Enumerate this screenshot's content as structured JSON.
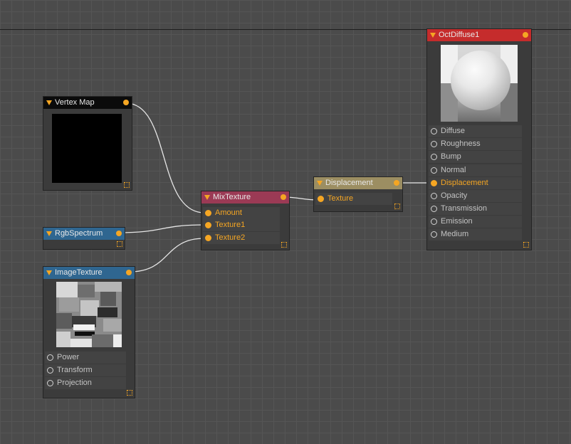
{
  "colors": {
    "accent": "#f5a623",
    "header_vertex_map": "#0b0b0b",
    "header_rgb_spectrum": "#2f6690",
    "header_image_texture": "#2f6690",
    "header_mix_texture": "#9b3a55",
    "header_displacement": "#9c8e62",
    "header_oct_diffuse": "#c52c2c"
  },
  "nodes": {
    "vertex_map": {
      "title": "Vertex Map"
    },
    "rgb_spectrum": {
      "title": "RgbSpectrum"
    },
    "image_texture": {
      "title": "ImageTexture",
      "pins": [
        "Power",
        "Transform",
        "Projection"
      ]
    },
    "mix_texture": {
      "title": "MixTexture",
      "pins": [
        "Amount",
        "Texture1",
        "Texture2"
      ]
    },
    "displacement": {
      "title": "Displacement",
      "pins": [
        "Texture"
      ]
    },
    "oct_diffuse": {
      "title": "OctDiffuse1",
      "pins": [
        "Diffuse",
        "Roughness",
        "Bump",
        "Normal",
        "Displacement",
        "Opacity",
        "Transmission",
        "Emission",
        "Medium"
      ]
    }
  },
  "connections": [
    {
      "from": "Vertex Map",
      "to": "MixTexture.Amount"
    },
    {
      "from": "RgbSpectrum",
      "to": "MixTexture.Texture1"
    },
    {
      "from": "ImageTexture",
      "to": "MixTexture.Texture2"
    },
    {
      "from": "MixTexture",
      "to": "Displacement.Texture"
    },
    {
      "from": "Displacement",
      "to": "OctDiffuse1.Displacement"
    }
  ]
}
